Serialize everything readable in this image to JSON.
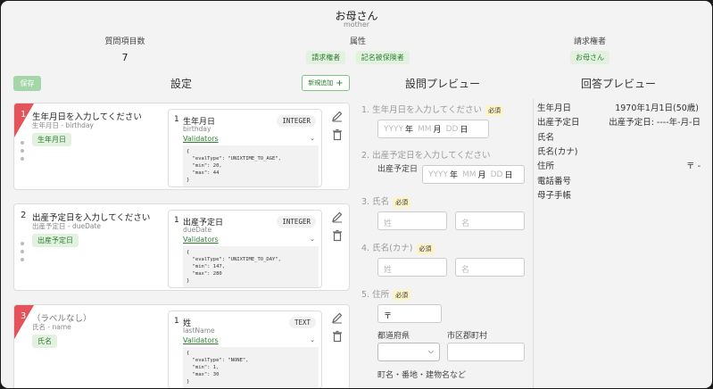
{
  "header": {
    "name": "お母さん",
    "key": "mother",
    "stats": {
      "count_label": "質問項目数",
      "count_value": "7",
      "attr_label": "属性",
      "attr_tags": [
        "請求権者",
        "記名被保険者"
      ],
      "claimant_label": "請求権者",
      "claimant_tag": "お母さん"
    }
  },
  "toolbar": {
    "save_label": "保存",
    "settings_title": "設定",
    "add_label": "新規追加",
    "preview_title": "設問プレビュー",
    "answer_title": "回答プレビュー"
  },
  "colors": {
    "accent": "#2e7d32",
    "required_marker": "#e4525a"
  },
  "cards": [
    {
      "num": "1",
      "title": "生年月日を入力してください",
      "sub": "生年月日 - birthday",
      "tag": "生年月日",
      "field_num": "1",
      "field_title": "生年月日",
      "field_key": "birthday",
      "field_type": "INTEGER",
      "validators_label": "Validators",
      "validator_json": "{\n  \"evalType\": \"UNIXTIME_TO_AGE\",\n  \"min\": 20,\n  \"max\": 44\n}"
    },
    {
      "num": "2",
      "title": "出産予定日を入力してください",
      "sub": "出産予定日 - dueDate",
      "tag": "出産予定日",
      "field_num": "1",
      "field_title": "出産予定日",
      "field_key": "dueDate",
      "field_type": "INTEGER",
      "validators_label": "Validators",
      "validator_json": "{\n  \"evalType\": \"UNIXTIME_TO_DAY\",\n  \"min\": 147,\n  \"max\": 280\n}"
    },
    {
      "num": "3",
      "title": "（ラベルなし）",
      "sub": "氏名 - name",
      "tag": "氏名",
      "field_num": "1",
      "field_title": "姓",
      "field_key": "lastName",
      "field_type": "TEXT",
      "validators_label": "Validators",
      "validator_json": "{\n  \"evalType\": \"NONE\",\n  \"min\": 1,\n  \"max\": 30\n}"
    }
  ],
  "preview": {
    "required": "必須",
    "q1": "1. 生年月日を入力してください",
    "q2": "2. 出産予定日を入力してください",
    "q2_label": "出産予定日",
    "q3": "3. 氏名",
    "q4": "4. 氏名(カナ)",
    "q5": "5. 住所",
    "ph_year": "YYYY",
    "u_year": "年",
    "ph_month": "MM",
    "u_month": "月",
    "ph_day": "DD",
    "u_day": "日",
    "ph_sei": "姓",
    "ph_mei": "名",
    "postal": "〒",
    "pref": "都道府県",
    "city": "市区郡町村",
    "street": "町名・番地・建物名など"
  },
  "answer": {
    "rows": [
      {
        "label": "生年月日",
        "value": "1970年1月1日(50歳)"
      },
      {
        "label": "出産予定日",
        "value": "出産予定日: ----年-月-日"
      },
      {
        "label": "氏名",
        "value": ""
      },
      {
        "label": "氏名(カナ)",
        "value": ""
      },
      {
        "label": "住所",
        "value": "〒 -"
      },
      {
        "label": "電話番号",
        "value": ""
      },
      {
        "label": "母子手帳",
        "value": ""
      }
    ]
  }
}
